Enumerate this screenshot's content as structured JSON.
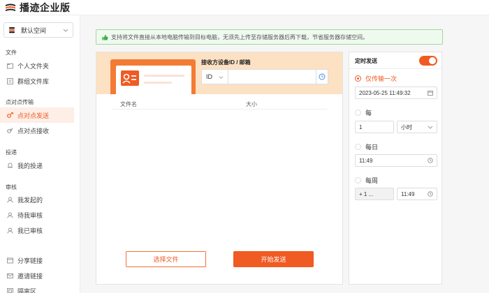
{
  "app": {
    "title": "播迹企业版",
    "brand_color": "#f05a23"
  },
  "sidebar": {
    "workspace": "默认空间",
    "sections": [
      {
        "label": "文件",
        "items": [
          {
            "label": "个人文件夹",
            "icon": "folder-icon"
          },
          {
            "label": "群组文件库",
            "icon": "library-icon"
          }
        ]
      },
      {
        "label": "点对点传输",
        "items": [
          {
            "label": "点对点发送",
            "icon": "send-icon",
            "active": true
          },
          {
            "label": "点对点接收",
            "icon": "receive-icon"
          }
        ]
      },
      {
        "label": "投递",
        "items": [
          {
            "label": "我的投递",
            "icon": "bell-icon"
          }
        ]
      },
      {
        "label": "审核",
        "items": [
          {
            "label": "我发起的",
            "icon": "user-icon"
          },
          {
            "label": "待我审核",
            "icon": "user-icon"
          },
          {
            "label": "我已审核",
            "icon": "user-icon"
          }
        ]
      },
      {
        "label": "",
        "items": [
          {
            "label": "分享链接",
            "icon": "link-icon"
          },
          {
            "label": "邀请链接",
            "icon": "mail-icon"
          },
          {
            "label": "隔离区",
            "icon": "quarantine-icon"
          }
        ]
      }
    ]
  },
  "notice": "支持将文件直接从本地电脑传输到目标电脑，无须先上传至存储服务器后再下载，节省服务器存储空间。",
  "send_panel": {
    "receiver_label": "接收方设备ID / 邮箱",
    "receiver_type": "ID",
    "receiver_value": "",
    "columns": {
      "name": "文件名",
      "size": "大小"
    },
    "choose_button": "选择文件",
    "send_button": "开始发送"
  },
  "schedule": {
    "title": "定时发送",
    "enabled": true,
    "once": {
      "label": "仅传输一次",
      "datetime": "2023-05-25 11:49:32",
      "selected": true
    },
    "every": {
      "label": "每",
      "count": "1",
      "unit": "小时"
    },
    "daily": {
      "label": "每日",
      "time": "11:49"
    },
    "weekly": {
      "label": "每周",
      "days": "+ 1 ...",
      "time": "11:49"
    }
  }
}
